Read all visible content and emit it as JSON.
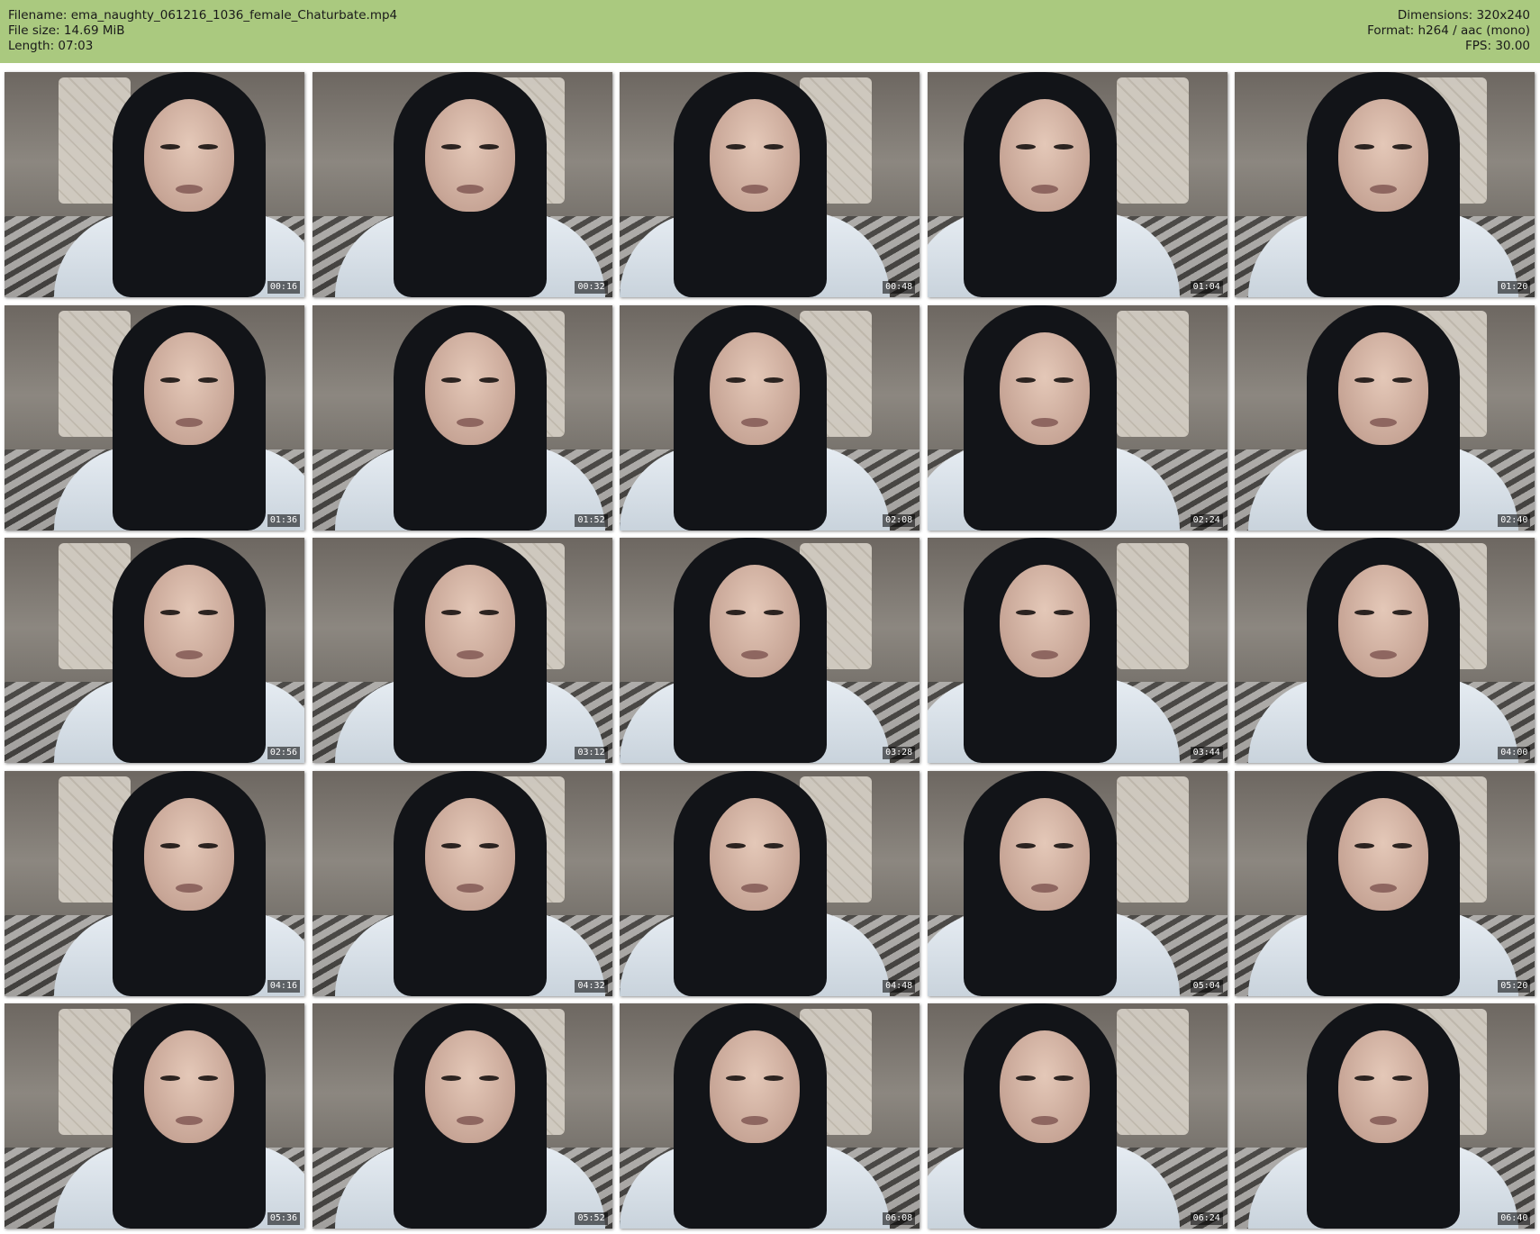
{
  "header": {
    "filename_label": "Filename:",
    "filename": "ema_naughty_061216_1036_female_Chaturbate.mp4",
    "filesize_label": "File size:",
    "filesize": "14.69 MiB",
    "length_label": "Length:",
    "length": "07:03",
    "dimensions_label": "Dimensions:",
    "dimensions": "320x240",
    "format_label": "Format:",
    "format": "h264 / aac (mono)",
    "fps_label": "FPS:",
    "fps": "30.00"
  },
  "colors": {
    "header_bg": "#aac97f",
    "page_bg": "#ffffff"
  },
  "thumbnails": [
    {
      "timestamp": "00:16"
    },
    {
      "timestamp": "00:32"
    },
    {
      "timestamp": "00:48"
    },
    {
      "timestamp": "01:04"
    },
    {
      "timestamp": "01:20"
    },
    {
      "timestamp": "01:36"
    },
    {
      "timestamp": "01:52"
    },
    {
      "timestamp": "02:08"
    },
    {
      "timestamp": "02:24"
    },
    {
      "timestamp": "02:40"
    },
    {
      "timestamp": "02:56"
    },
    {
      "timestamp": "03:12"
    },
    {
      "timestamp": "03:28"
    },
    {
      "timestamp": "03:44"
    },
    {
      "timestamp": "04:00"
    },
    {
      "timestamp": "04:16"
    },
    {
      "timestamp": "04:32"
    },
    {
      "timestamp": "04:48"
    },
    {
      "timestamp": "05:04"
    },
    {
      "timestamp": "05:20"
    },
    {
      "timestamp": "05:36"
    },
    {
      "timestamp": "05:52"
    },
    {
      "timestamp": "06:08"
    },
    {
      "timestamp": "06:24"
    },
    {
      "timestamp": "06:40"
    }
  ]
}
